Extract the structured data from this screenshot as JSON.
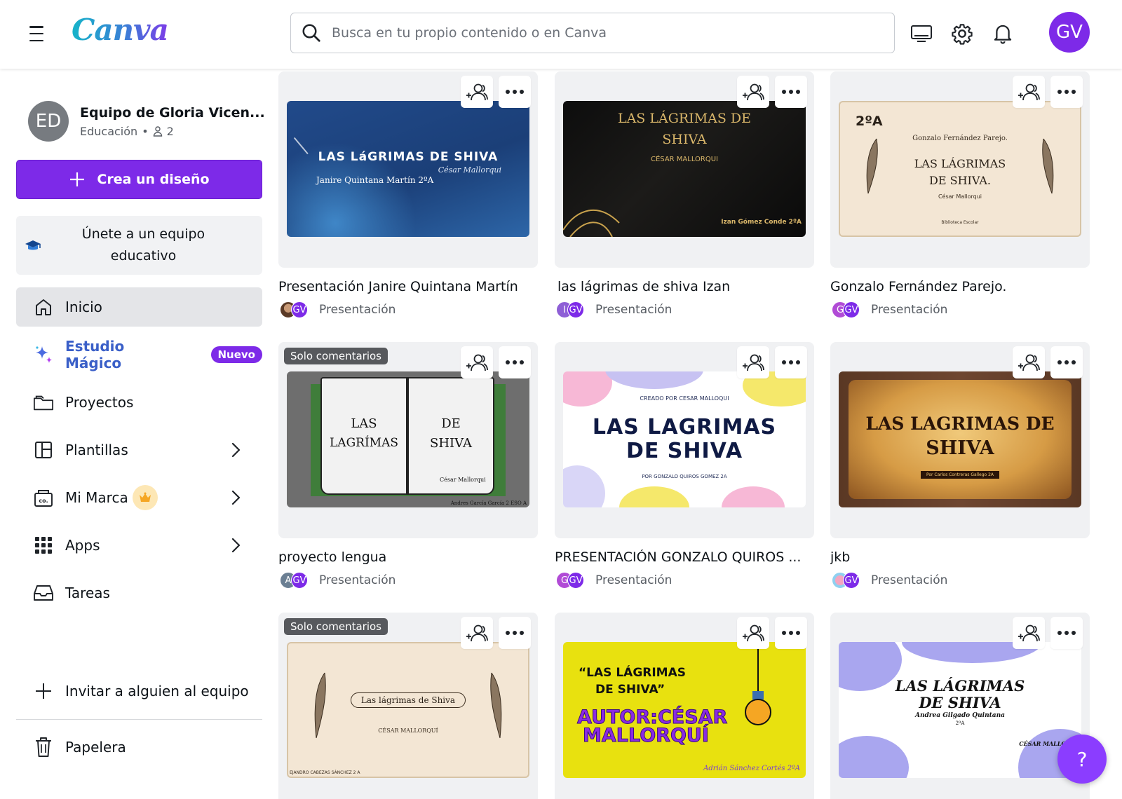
{
  "header": {
    "logo": "Canva",
    "search_placeholder": "Busca en tu propio contenido o en Canva",
    "user_initials": "GV"
  },
  "sidebar": {
    "team_initials": "ED",
    "team_name": "Equipo de Gloria Vicen...",
    "team_plan": "Educación",
    "team_separator": "•",
    "team_members": "2",
    "create_label": "Crea un diseño",
    "join_line1": "Únete a un equipo",
    "join_line2": "educativo",
    "nav": {
      "inicio": "Inicio",
      "magic": "Estudio Mágico",
      "magic_badge": "Nuevo",
      "proyectos": "Proyectos",
      "plantillas": "Plantillas",
      "marca": "Mi Marca",
      "apps": "Apps",
      "tareas": "Tareas",
      "invitar": "Invitar a alguien al equipo",
      "papelera": "Papelera"
    }
  },
  "designs": [
    {
      "title": "Presentación Janire Quintana Martín",
      "type": "Presentación",
      "owner_initial": "",
      "thumb_title": "LAS LáGRIMAS DE SHIVA",
      "thumb_sub": "Janire Quintana Martín 2ºA",
      "thumb_sig": "César Mallorqui",
      "solo": ""
    },
    {
      "title": "las lágrimas de shiva Izan",
      "type": "Presentación",
      "owner_initial": "I",
      "thumb_title_1": "LAS LÁGRIMAS DE",
      "thumb_title_2": "SHIVA",
      "thumb_sub": "CÉSAR MALLORQUI",
      "thumb_author": "Izan Gómez Conde  2ºA",
      "solo": ""
    },
    {
      "title": "Gonzalo Fernández Parejo.",
      "type": "Presentación",
      "owner_initial": "G",
      "thumb_corner": "2ºA",
      "thumb_banner": "Gonzalo Fernández Parejo.",
      "thumb_title_1": "LAS LÁGRIMAS",
      "thumb_title_2": "DE SHIVA.",
      "thumb_sub": "César Mallorqui",
      "thumb_footer": "Biblioteca Escolar",
      "solo": ""
    },
    {
      "title": "proyecto lengua",
      "type": "Presentación",
      "owner_initial": "A",
      "thumb_left_1": "LAS",
      "thumb_left_2": "LAGRÍMAS",
      "thumb_right_1": "DE",
      "thumb_right_2": "SHIVA",
      "thumb_sig": "César Mallorqui",
      "thumb_author": "Andres García García    2 ESO A",
      "solo": "Solo comentarios"
    },
    {
      "title": "PRESENTACIÓN GONZALO QUIROS ...",
      "type": "Presentación",
      "owner_initial": "G",
      "thumb_top": "CREADO POR CESAR MALLOQUI",
      "thumb_title_1": "LAS LAGRIMAS",
      "thumb_title_2": "DE SHIVA",
      "thumb_sub": "POR GONZALO QUIROS GOMEZ 2A",
      "solo": ""
    },
    {
      "title": "jkb",
      "type": "Presentación",
      "owner_initial": "",
      "thumb_title_1": "LAS LAGRIMAS DE",
      "thumb_title_2": "SHIVA",
      "thumb_sub": "Por Carlos Contreras Gallego 2A",
      "solo": ""
    },
    {
      "title": "",
      "type": "",
      "owner_initial": "",
      "thumb_banner": "Las lágrimas de Shiva",
      "thumb_sub": "CÉSAR MALLORQUÍ",
      "thumb_author": "EJANDRO CABEZAS SÁNCHEZ 2 A",
      "solo": "Solo comentarios"
    },
    {
      "title": "",
      "type": "",
      "owner_initial": "",
      "thumb_title_1": "“LAS LÁGRIMAS",
      "thumb_title_2": "DE SHIVA”",
      "thumb_author_1": "AUTOR:CÉSAR",
      "thumb_author_2": "MALLORQUÍ",
      "thumb_sig": "Adrián Sánchez Cortés 2ºA",
      "solo": ""
    },
    {
      "title": "",
      "type": "",
      "owner_initial": "",
      "thumb_title_1": "LAS LÁGRIMAS",
      "thumb_title_2": "DE SHIVA",
      "thumb_sub": "Andrea Gilgado Quintana",
      "thumb_sub2": "2ºA",
      "thumb_sig": "CÉSAR MALLORQ",
      "solo": ""
    }
  ],
  "help_label": "?",
  "colors": {
    "brand_purple": "#7d2ae8",
    "magic_blue": "#3a5fc8"
  }
}
